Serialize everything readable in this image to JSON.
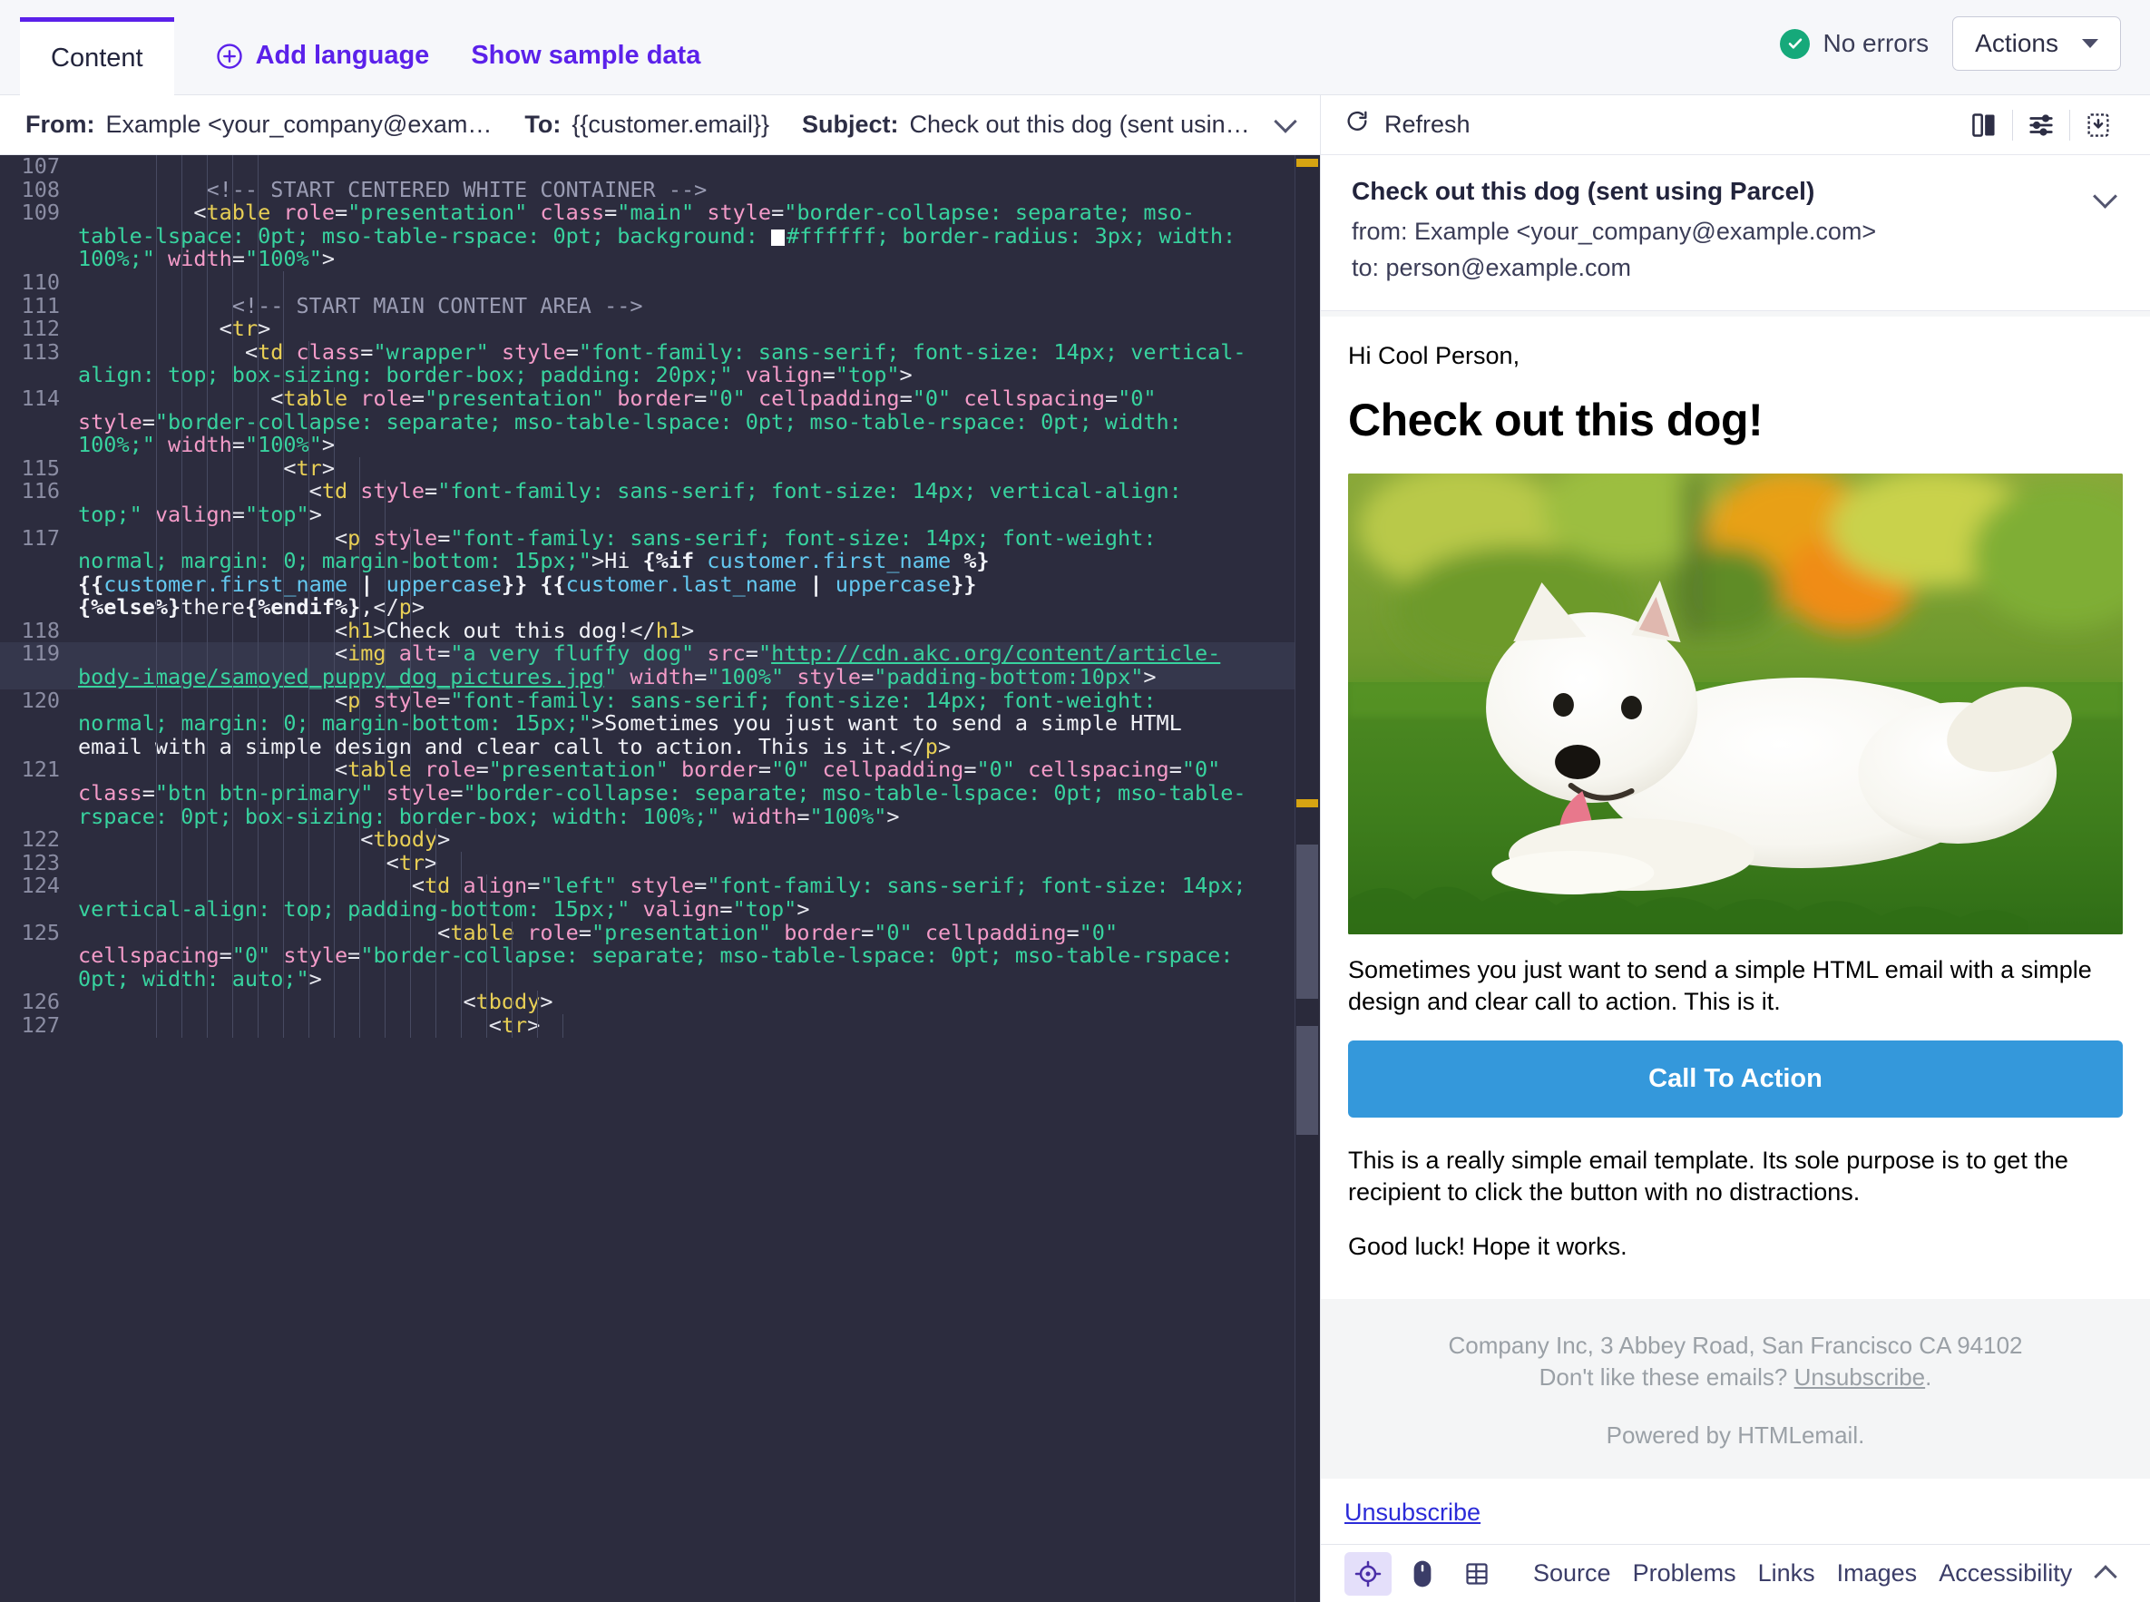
{
  "topbar": {
    "tab_content": "Content",
    "add_language": "Add language",
    "show_sample_data": "Show sample data",
    "no_errors": "No errors",
    "actions": "Actions",
    "accent_color": "#5b21ea",
    "success_color": "#16a97a",
    "icons": {
      "plus": "plus-circle-icon",
      "check": "check-circle-icon",
      "caret": "caret-down-icon"
    }
  },
  "envelope": {
    "from_label": "From:",
    "from_value": "Example <your_company@exam…",
    "to_label": "To:",
    "to_value": "{{customer.email}}",
    "subject_label": "Subject:",
    "subject_value": "Check out this dog (sent usin…"
  },
  "editor": {
    "lines": [
      {
        "num": "107",
        "indent": 5,
        "html": ""
      },
      {
        "num": "108",
        "indent": 5,
        "html": "<span class='sp'>          </span><span class='t-comment'>&lt;!-- START CENTERED WHITE CONTAINER --&gt;</span>"
      },
      {
        "num": "109",
        "indent": 5,
        "html": "<span class='sp'>         </span><span class='t-punct'>&lt;</span><span class='t-tag'>table</span> <span class='t-attr'>role</span><span class='t-punct'>=</span><span class='t-val'>\"presentation\"</span> <span class='t-attr'>class</span><span class='t-punct'>=</span><span class='t-val'>\"main\"</span> <span class='t-attr'>style</span><span class='t-punct'>=</span><span class='t-val'>\"border-collapse: separate; mso-table-lspace: 0pt; mso-table-rspace: 0pt; background: </span><span class='swatch'></span><span class='t-val'>#ffffff; border-radius: 3px; width: 100%;\"</span> <span class='t-attr'>width</span><span class='t-punct'>=</span><span class='t-val'>\"100%\"</span><span class='t-punct'>&gt;</span>"
      },
      {
        "num": "110",
        "indent": 6,
        "html": ""
      },
      {
        "num": "111",
        "indent": 6,
        "html": "<span class='sp'>            </span><span class='t-comment'>&lt;!-- START MAIN CONTENT AREA --&gt;</span>"
      },
      {
        "num": "112",
        "indent": 6,
        "html": "<span class='sp'>           </span><span class='t-punct'>&lt;</span><span class='t-tag'>tr</span><span class='t-punct'>&gt;</span>"
      },
      {
        "num": "113",
        "indent": 7,
        "html": "<span class='sp'>             </span><span class='t-punct'>&lt;</span><span class='t-tag'>td</span> <span class='t-attr'>class</span><span class='t-punct'>=</span><span class='t-val'>\"wrapper\"</span> <span class='t-attr'>style</span><span class='t-punct'>=</span><span class='t-val'>\"font-family: sans-serif; font-size: 14px; vertical-align: top; box-sizing: border-box; padding: 20px;\"</span> <span class='t-attr'>valign</span><span class='t-punct'>=</span><span class='t-val'>\"top\"</span><span class='t-punct'>&gt;</span>"
      },
      {
        "num": "114",
        "indent": 8,
        "html": "<span class='sp'>               </span><span class='t-punct'>&lt;</span><span class='t-tag'>table</span> <span class='t-attr'>role</span><span class='t-punct'>=</span><span class='t-val'>\"presentation\"</span> <span class='t-attr'>border</span><span class='t-punct'>=</span><span class='t-val'>\"0\"</span> <span class='t-attr'>cellpadding</span><span class='t-punct'>=</span><span class='t-val'>\"0\"</span> <span class='t-attr'>cellspacing</span><span class='t-punct'>=</span><span class='t-val'>\"0\"</span> <span class='t-attr'>style</span><span class='t-punct'>=</span><span class='t-val'>\"border-collapse: separate; mso-table-lspace: 0pt; mso-table-rspace: 0pt; width: 100%;\"</span> <span class='t-attr'>width</span><span class='t-punct'>=</span><span class='t-val'>\"100%\"</span><span class='t-punct'>&gt;</span>"
      },
      {
        "num": "115",
        "indent": 9,
        "html": "<span class='sp'>                </span><span class='t-punct'>&lt;</span><span class='t-tag'>tr</span><span class='t-punct'>&gt;</span>"
      },
      {
        "num": "116",
        "indent": 10,
        "html": "<span class='sp'>                  </span><span class='t-punct'>&lt;</span><span class='t-tag'>td</span> <span class='t-attr'>style</span><span class='t-punct'>=</span><span class='t-val'>\"font-family: sans-serif; font-size: 14px; vertical-align: top;\"</span> <span class='t-attr'>valign</span><span class='t-punct'>=</span><span class='t-val'>\"top\"</span><span class='t-punct'>&gt;</span>"
      },
      {
        "num": "117",
        "indent": 11,
        "html": "<span class='sp'>                    </span><span class='t-punct'>&lt;</span><span class='t-tag'>p</span> <span class='t-attr'>style</span><span class='t-punct'>=</span><span class='t-val'>\"font-family: sans-serif; font-size: 14px; font-weight: normal; margin: 0; margin-bottom: 15px;\"</span><span class='t-punct'>&gt;</span><span class='t-text'>Hi </span><span class='t-kw'>{%if </span><span class='t-var'>customer.first_name</span><span class='t-kw'> %}</span><span class='t-text'> </span><span class='t-kw'>{{</span><span class='t-var'>customer.first_name</span><span class='t-kw'> | </span><span class='t-var'>uppercase</span><span class='t-kw'>}}</span><span class='t-text'> </span><span class='t-kw'>{{</span><span class='t-var'>customer.last_name</span><span class='t-kw'> | </span><span class='t-var'>uppercase</span><span class='t-kw'>}}{%else%}</span><span class='t-text'>there</span><span class='t-kw'>{%endif%}</span><span class='t-text'>,</span><span class='t-punct'>&lt;/</span><span class='t-tag'>p</span><span class='t-punct'>&gt;</span>"
      },
      {
        "num": "118",
        "indent": 11,
        "html": "<span class='sp'>                    </span><span class='t-punct'>&lt;</span><span class='t-tag'>h1</span><span class='t-punct'>&gt;</span><span class='t-text'>Check out this dog!</span><span class='t-punct'>&lt;/</span><span class='t-tag'>h1</span><span class='t-punct'>&gt;</span>"
      },
      {
        "num": "119",
        "indent": 11,
        "hl": true,
        "html": "<span class='sp'>                    </span><span class='t-punct'>&lt;</span><span class='t-tag'>img</span> <span class='t-attr'>alt</span><span class='t-punct'>=</span><span class='t-val'>\"a very fluffy dog\"</span> <span class='t-attr'>src</span><span class='t-punct'>=</span><span class='t-val'>\"</span><span class='t-link'>http://cdn.akc.org/content/article-body-image/samoyed_puppy_dog_pictures.jpg</span><span class='t-val'>\"</span> <span class='t-attr'>width</span><span class='t-punct'>=</span><span class='t-val'>\"100%\"</span> <span class='t-attr'>style</span><span class='t-punct'>=</span><span class='t-val'>\"padding-bottom:10px\"</span><span class='t-punct'>&gt;</span>"
      },
      {
        "num": "120",
        "indent": 11,
        "html": "<span class='sp'>                    </span><span class='t-punct'>&lt;</span><span class='t-tag'>p</span> <span class='t-attr'>style</span><span class='t-punct'>=</span><span class='t-val'>\"font-family: sans-serif; font-size: 14px; font-weight: normal; margin: 0; margin-bottom: 15px;\"</span><span class='t-punct'>&gt;</span><span class='t-text'>Sometimes you just want to send a simple HTML email with a simple design and clear call to action. This is it.</span><span class='t-punct'>&lt;/</span><span class='t-tag'>p</span><span class='t-punct'>&gt;</span>"
      },
      {
        "num": "121",
        "indent": 11,
        "html": "<span class='sp'>                    </span><span class='t-punct'>&lt;</span><span class='t-tag'>table</span> <span class='t-attr'>role</span><span class='t-punct'>=</span><span class='t-val'>\"presentation\"</span> <span class='t-attr'>border</span><span class='t-punct'>=</span><span class='t-val'>\"0\"</span> <span class='t-attr'>cellpadding</span><span class='t-punct'>=</span><span class='t-val'>\"0\"</span> <span class='t-attr'>cellspacing</span><span class='t-punct'>=</span><span class='t-val'>\"0\"</span> <span class='t-attr'>class</span><span class='t-punct'>=</span><span class='t-val'>\"btn btn-primary\"</span> <span class='t-attr'>style</span><span class='t-punct'>=</span><span class='t-val'>\"border-collapse: separate; mso-table-lspace: 0pt; mso-table-rspace: 0pt; box-sizing: border-box; width: 100%;\"</span> <span class='t-attr'>width</span><span class='t-punct'>=</span><span class='t-val'>\"100%\"</span><span class='t-punct'>&gt;</span>"
      },
      {
        "num": "122",
        "indent": 12,
        "html": "<span class='sp'>                      </span><span class='t-punct'>&lt;</span><span class='t-tag'>tbody</span><span class='t-punct'>&gt;</span>"
      },
      {
        "num": "123",
        "indent": 13,
        "html": "<span class='sp'>                        </span><span class='t-punct'>&lt;</span><span class='t-tag'>tr</span><span class='t-punct'>&gt;</span>"
      },
      {
        "num": "124",
        "indent": 14,
        "html": "<span class='sp'>                          </span><span class='t-punct'>&lt;</span><span class='t-tag'>td</span> <span class='t-attr'>align</span><span class='t-punct'>=</span><span class='t-val'>\"left\"</span> <span class='t-attr'>style</span><span class='t-punct'>=</span><span class='t-val'>\"font-family: sans-serif; font-size: 14px; vertical-align: top; padding-bottom: 15px;\"</span> <span class='t-attr'>valign</span><span class='t-punct'>=</span><span class='t-val'>\"top\"</span><span class='t-punct'>&gt;</span>"
      },
      {
        "num": "125",
        "indent": 15,
        "html": "<span class='sp'>                            </span><span class='t-punct'>&lt;</span><span class='t-tag'>table</span> <span class='t-attr'>role</span><span class='t-punct'>=</span><span class='t-val'>\"presentation\"</span> <span class='t-attr'>border</span><span class='t-punct'>=</span><span class='t-val'>\"0\"</span> <span class='t-attr'>cellpadding</span><span class='t-punct'>=</span><span class='t-val'>\"0\"</span> <span class='t-attr'>cellspacing</span><span class='t-punct'>=</span><span class='t-val'>\"0\"</span> <span class='t-attr'>style</span><span class='t-punct'>=</span><span class='t-val'>\"border-collapse: separate; mso-table-lspace: 0pt; mso-table-rspace: 0pt; width: auto;\"</span><span class='t-punct'>&gt;</span>"
      },
      {
        "num": "126",
        "indent": 16,
        "html": "<span class='sp'>                              </span><span class='t-punct'>&lt;</span><span class='t-tag'>tbody</span><span class='t-punct'>&gt;</span>"
      },
      {
        "num": "127",
        "indent": 17,
        "html": "<span class='sp'>                                </span><span class='t-punct'>&lt;</span><span class='t-tag'>tr</span><span class='t-punct'>&gt;</span>"
      }
    ]
  },
  "preview": {
    "refresh": "Refresh",
    "icons": {
      "refresh": "refresh-icon",
      "split_view": "split-view-icon",
      "settings_sliders": "sliders-icon",
      "screenshot": "screenshot-icon",
      "collapse": "chevron-down-icon"
    },
    "subject": "Check out this dog (sent using Parcel)",
    "from": "from: Example <your_company@example.com>",
    "to": "to: person@example.com"
  },
  "email": {
    "greeting": "Hi Cool Person,",
    "heading": "Check out this dog!",
    "image_alt": "a very fluffy dog",
    "paragraph_1": "Sometimes you just want to send a simple HTML email with a simple design and clear call to action. This is it.",
    "cta_label": "Call To Action",
    "cta_color": "#3498db",
    "paragraph_2": "This is a really simple email template. Its sole purpose is to get the recipient to click the button with no distractions.",
    "paragraph_3": "Good luck! Hope it works.",
    "footer_address": "Company Inc, 3 Abbey Road, San Francisco CA 94102",
    "footer_unsub_prefix": "Don't like these emails? ",
    "footer_unsub_link": "Unsubscribe",
    "footer_unsub_suffix": ".",
    "footer_powered": "Powered by HTMLemail.",
    "bottom_unsubscribe": "Unsubscribe"
  },
  "statusbar": {
    "icons": {
      "target": "target-inspect-icon",
      "mouse": "mouse-pointer-icon",
      "grid": "grid-layout-icon",
      "collapse": "chevron-up-icon"
    },
    "tabs": [
      "Source",
      "Problems",
      "Links",
      "Images",
      "Accessibility"
    ]
  }
}
